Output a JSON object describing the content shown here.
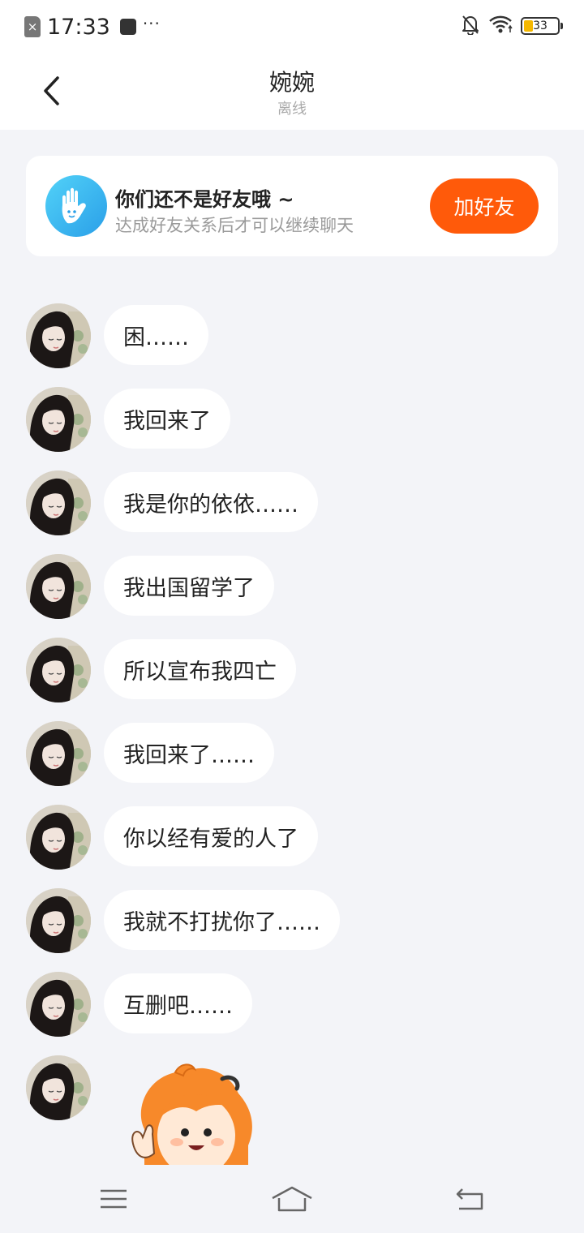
{
  "status_bar": {
    "time": "17:33",
    "dots": "···",
    "battery": "33",
    "battery_level_percent": 33,
    "battery_color": "#f5b800"
  },
  "header": {
    "name": "婉婉",
    "status": "离线",
    "back_icon": "chevron-left-icon"
  },
  "friend_card": {
    "icon": "hand-icon",
    "title": "你们还不是好友哦 ~",
    "subtitle": "达成好友关系后才可以继续聊天",
    "button_label": "加好友",
    "button_color": "#ff5a0a"
  },
  "messages": [
    {
      "text": "困……"
    },
    {
      "text": "我回来了"
    },
    {
      "text": "我是你的依依……"
    },
    {
      "text": "我出国留学了"
    },
    {
      "text": "所以宣布我四亡"
    },
    {
      "text": "我回来了……"
    },
    {
      "text": "你以经有爱的人了"
    },
    {
      "text": "我就不打扰你了……"
    },
    {
      "text": "互删吧……"
    }
  ],
  "sticker": {
    "icon": "waving-cartoon-sticker"
  },
  "nav_bar": {
    "icons": [
      "menu-icon",
      "home-icon",
      "back-arrow-icon"
    ]
  }
}
